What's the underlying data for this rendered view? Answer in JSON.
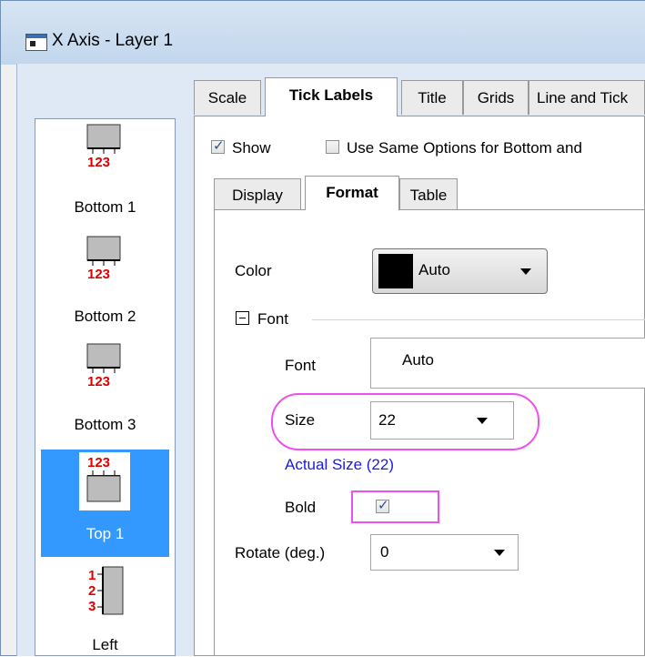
{
  "window": {
    "title": "X Axis - Layer 1"
  },
  "axis_list": {
    "items": [
      {
        "label": "Bottom 1",
        "icon": "bottom-axis-icon",
        "tick_labels": "123"
      },
      {
        "label": "Bottom 2",
        "icon": "bottom-axis-icon",
        "tick_labels": "123"
      },
      {
        "label": "Bottom 3",
        "icon": "bottom-axis-icon",
        "tick_labels": "123"
      },
      {
        "label": "Top 1",
        "icon": "top-axis-icon",
        "tick_labels": "123",
        "selected": true
      },
      {
        "label": "Left",
        "icon": "left-axis-icon",
        "tick_labels": [
          "1",
          "2",
          "3"
        ]
      }
    ]
  },
  "main_tabs": [
    "Scale",
    "Tick Labels",
    "Title",
    "Grids",
    "Line and Tick"
  ],
  "active_main_tab": "Tick Labels",
  "show": {
    "label": "Show",
    "checked": true
  },
  "use_same": {
    "label": "Use Same Options for Bottom and",
    "checked": false
  },
  "sub_tabs": [
    "Display",
    "Format",
    "Table"
  ],
  "active_sub_tab": "Format",
  "format": {
    "color_label": "Color",
    "color_value": "Auto",
    "color_swatch": "#000000",
    "font_group_label": "Font",
    "font_label": "Font",
    "font_value": "Auto",
    "size_label": "Size",
    "size_value": "22",
    "actual_size": "Actual Size (22)",
    "bold_label": "Bold",
    "bold_checked": true,
    "rotate_label": "Rotate (deg.)",
    "rotate_value": "0"
  },
  "colors": {
    "selection": "#3399ff",
    "highlight": "#ef4ef0",
    "tick_label_red": "#e00000",
    "link_blue": "#1a1ae6"
  }
}
